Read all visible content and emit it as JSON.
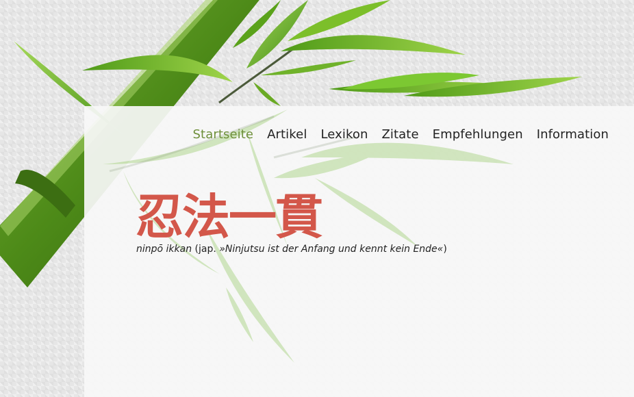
{
  "nav": {
    "items": [
      {
        "label": "Startseite",
        "active": true
      },
      {
        "label": "Artikel",
        "active": false
      },
      {
        "label": "Lexikon",
        "active": false
      },
      {
        "label": "Zitate",
        "active": false
      },
      {
        "label": "Empfehlungen",
        "active": false
      },
      {
        "label": "Information",
        "active": false
      }
    ]
  },
  "hero": {
    "kanji": "忍法一貫",
    "romaji": "ninpō ikkan",
    "paren_open": " (jap. ",
    "translation": "»Ninjutsu ist der Anfang und kennt kein Ende«",
    "paren_close": ")"
  },
  "colors": {
    "accent_nav_active": "#6e8f3a",
    "kanji_red": "#d3574a",
    "bamboo_green": "#3f7d14",
    "leaf_green": "#7cbf2a"
  }
}
